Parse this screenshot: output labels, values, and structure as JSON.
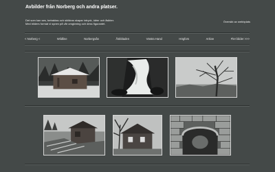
{
  "site": {
    "title": "Avbilder från Norberg och andra platser.",
    "intro_line1": "Det som kan ses, betraktas och skildras skapar intryck, idéer och åsikter.",
    "intro_line2": "Med bilders format vi synen på vår omgivning och dess figurantet.",
    "overview_link": "Översikt av webbplats"
  },
  "nav": {
    "items": [
      {
        "label": "< Norberg <"
      },
      {
        "label": "Wildline"
      },
      {
        "label": "Norbergsån"
      },
      {
        "label": "Åskbladen"
      },
      {
        "label": "Västra Hand"
      },
      {
        "label": "Högfors"
      },
      {
        "label": "Arkive"
      },
      {
        "label": "Fler bilder >>>"
      }
    ]
  },
  "gallery": {
    "photos": [
      {
        "icon": "cabin-in-snow-photo"
      },
      {
        "icon": "waterfall-photo"
      },
      {
        "icon": "bare-tree-photo"
      },
      {
        "icon": "old-barn-photo"
      },
      {
        "icon": "abandoned-house-photo"
      },
      {
        "icon": "stone-arch-photo"
      }
    ]
  },
  "colors": {
    "background": "#444948",
    "thumb_border": "#d8d8d8",
    "text": "#ffffff"
  }
}
